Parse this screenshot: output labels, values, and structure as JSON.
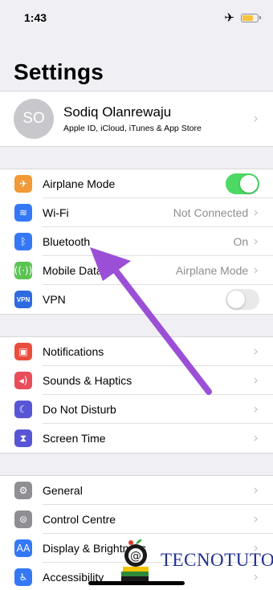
{
  "status_bar": {
    "time": "1:43",
    "airplane_glyph": "✈",
    "battery_color": "#f6c33b"
  },
  "page_title": "Settings",
  "profile": {
    "initials": "SO",
    "name": "Sodiq Olanrewaju",
    "subtitle": "Apple ID, iCloud, iTunes & App Store"
  },
  "groups": {
    "connectivity": [
      {
        "label": "Airplane Mode",
        "icon": "airplane-icon",
        "glyph": "✈",
        "color": "#f19a37",
        "toggle": "on"
      },
      {
        "label": "Wi-Fi",
        "icon": "wifi-icon",
        "glyph": "≋",
        "color": "#3478f6",
        "value": "Not Connected"
      },
      {
        "label": "Bluetooth",
        "icon": "bluetooth-icon",
        "glyph": "ᛒ",
        "color": "#3478f6",
        "value": "On"
      },
      {
        "label": "Mobile Data",
        "icon": "antenna-icon",
        "glyph": "((·))",
        "color": "#5ac453",
        "value": "Airplane Mode"
      },
      {
        "label": "VPN",
        "icon": "vpn-icon",
        "glyph": "VPN",
        "color": "#2f6be0",
        "toggle": "off"
      }
    ],
    "notifications": [
      {
        "label": "Notifications",
        "icon": "notifications-icon",
        "glyph": "▣",
        "color": "#ea4d3d"
      },
      {
        "label": "Sounds & Haptics",
        "icon": "speaker-icon",
        "glyph": "◂)",
        "color": "#ea4d5a"
      },
      {
        "label": "Do Not Disturb",
        "icon": "moon-icon",
        "glyph": "☾",
        "color": "#5856d6"
      },
      {
        "label": "Screen Time",
        "icon": "hourglass-icon",
        "glyph": "⧗",
        "color": "#5856d6"
      }
    ],
    "general": [
      {
        "label": "General",
        "icon": "gear-icon",
        "glyph": "⚙",
        "color": "#8e8e93"
      },
      {
        "label": "Control Centre",
        "icon": "switches-icon",
        "glyph": "⊜",
        "color": "#8e8e93"
      },
      {
        "label": "Display & Brightness",
        "icon": "display-icon",
        "glyph": "AA",
        "color": "#3478f6"
      },
      {
        "label": "Accessibility",
        "icon": "accessibility-icon",
        "glyph": "♿",
        "color": "#3478f6"
      }
    ]
  },
  "watermark": {
    "text": "TECNOTUTO"
  },
  "colors": {
    "toggle_on": "#4cd964",
    "arrow": "#9b4fd6",
    "chevron": "#c4c4c9"
  }
}
